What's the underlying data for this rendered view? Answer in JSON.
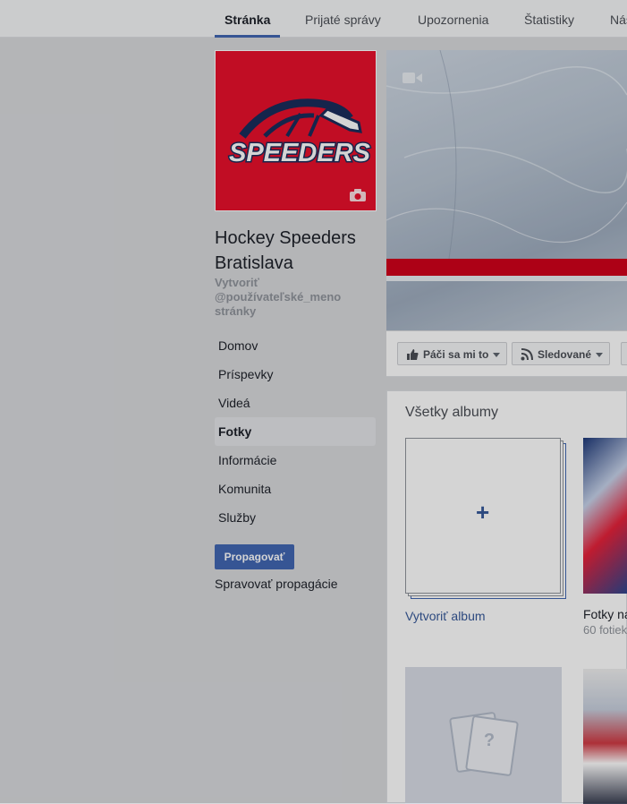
{
  "topnav": {
    "tabs": [
      {
        "label": "Stránka",
        "active": true
      },
      {
        "label": "Prijaté správy",
        "active": false
      },
      {
        "label": "Upozornenia",
        "active": false
      },
      {
        "label": "Štatistiky",
        "active": false
      },
      {
        "label": "Nás",
        "active": false
      }
    ]
  },
  "page": {
    "logo_text": "SPEEDERS",
    "name": "Hockey Speeders Bratislava",
    "username_prompt": "Vytvoriť @používateľské_meno stránky"
  },
  "sidebar": {
    "items": [
      {
        "label": "Domov"
      },
      {
        "label": "Príspevky"
      },
      {
        "label": "Videá"
      },
      {
        "label": "Fotky",
        "active": true
      },
      {
        "label": "Informácie"
      },
      {
        "label": "Komunita"
      },
      {
        "label": "Služby"
      }
    ],
    "promote_label": "Propagovať",
    "manage_promotions_label": "Spravovať propagácie"
  },
  "actions": {
    "like_label": "Páči sa mi to",
    "follow_label": "Sledované"
  },
  "albums": {
    "title": "Všetky albumy",
    "create_label": "Vytvoriť album",
    "items": [
      {
        "name": "Fotky na",
        "count": "60 fotiek"
      }
    ]
  },
  "colors": {
    "brand_blue": "#4267b2",
    "logo_red": "#e8102c",
    "logo_navy": "#1a2d5c"
  }
}
